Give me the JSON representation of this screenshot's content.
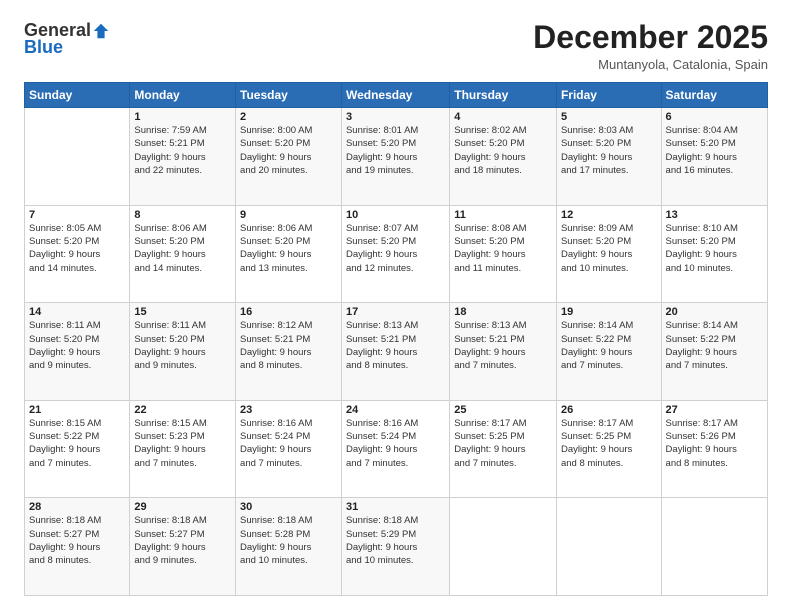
{
  "logo": {
    "general": "General",
    "blue": "Blue"
  },
  "header": {
    "month": "December 2025",
    "location": "Muntanyola, Catalonia, Spain"
  },
  "weekdays": [
    "Sunday",
    "Monday",
    "Tuesday",
    "Wednesday",
    "Thursday",
    "Friday",
    "Saturday"
  ],
  "weeks": [
    [
      {
        "day": "",
        "info": ""
      },
      {
        "day": "1",
        "info": "Sunrise: 7:59 AM\nSunset: 5:21 PM\nDaylight: 9 hours\nand 22 minutes."
      },
      {
        "day": "2",
        "info": "Sunrise: 8:00 AM\nSunset: 5:20 PM\nDaylight: 9 hours\nand 20 minutes."
      },
      {
        "day": "3",
        "info": "Sunrise: 8:01 AM\nSunset: 5:20 PM\nDaylight: 9 hours\nand 19 minutes."
      },
      {
        "day": "4",
        "info": "Sunrise: 8:02 AM\nSunset: 5:20 PM\nDaylight: 9 hours\nand 18 minutes."
      },
      {
        "day": "5",
        "info": "Sunrise: 8:03 AM\nSunset: 5:20 PM\nDaylight: 9 hours\nand 17 minutes."
      },
      {
        "day": "6",
        "info": "Sunrise: 8:04 AM\nSunset: 5:20 PM\nDaylight: 9 hours\nand 16 minutes."
      }
    ],
    [
      {
        "day": "7",
        "info": "Sunrise: 8:05 AM\nSunset: 5:20 PM\nDaylight: 9 hours\nand 14 minutes."
      },
      {
        "day": "8",
        "info": "Sunrise: 8:06 AM\nSunset: 5:20 PM\nDaylight: 9 hours\nand 14 minutes."
      },
      {
        "day": "9",
        "info": "Sunrise: 8:06 AM\nSunset: 5:20 PM\nDaylight: 9 hours\nand 13 minutes."
      },
      {
        "day": "10",
        "info": "Sunrise: 8:07 AM\nSunset: 5:20 PM\nDaylight: 9 hours\nand 12 minutes."
      },
      {
        "day": "11",
        "info": "Sunrise: 8:08 AM\nSunset: 5:20 PM\nDaylight: 9 hours\nand 11 minutes."
      },
      {
        "day": "12",
        "info": "Sunrise: 8:09 AM\nSunset: 5:20 PM\nDaylight: 9 hours\nand 10 minutes."
      },
      {
        "day": "13",
        "info": "Sunrise: 8:10 AM\nSunset: 5:20 PM\nDaylight: 9 hours\nand 10 minutes."
      }
    ],
    [
      {
        "day": "14",
        "info": "Sunrise: 8:11 AM\nSunset: 5:20 PM\nDaylight: 9 hours\nand 9 minutes."
      },
      {
        "day": "15",
        "info": "Sunrise: 8:11 AM\nSunset: 5:20 PM\nDaylight: 9 hours\nand 9 minutes."
      },
      {
        "day": "16",
        "info": "Sunrise: 8:12 AM\nSunset: 5:21 PM\nDaylight: 9 hours\nand 8 minutes."
      },
      {
        "day": "17",
        "info": "Sunrise: 8:13 AM\nSunset: 5:21 PM\nDaylight: 9 hours\nand 8 minutes."
      },
      {
        "day": "18",
        "info": "Sunrise: 8:13 AM\nSunset: 5:21 PM\nDaylight: 9 hours\nand 7 minutes."
      },
      {
        "day": "19",
        "info": "Sunrise: 8:14 AM\nSunset: 5:22 PM\nDaylight: 9 hours\nand 7 minutes."
      },
      {
        "day": "20",
        "info": "Sunrise: 8:14 AM\nSunset: 5:22 PM\nDaylight: 9 hours\nand 7 minutes."
      }
    ],
    [
      {
        "day": "21",
        "info": "Sunrise: 8:15 AM\nSunset: 5:22 PM\nDaylight: 9 hours\nand 7 minutes."
      },
      {
        "day": "22",
        "info": "Sunrise: 8:15 AM\nSunset: 5:23 PM\nDaylight: 9 hours\nand 7 minutes."
      },
      {
        "day": "23",
        "info": "Sunrise: 8:16 AM\nSunset: 5:24 PM\nDaylight: 9 hours\nand 7 minutes."
      },
      {
        "day": "24",
        "info": "Sunrise: 8:16 AM\nSunset: 5:24 PM\nDaylight: 9 hours\nand 7 minutes."
      },
      {
        "day": "25",
        "info": "Sunrise: 8:17 AM\nSunset: 5:25 PM\nDaylight: 9 hours\nand 7 minutes."
      },
      {
        "day": "26",
        "info": "Sunrise: 8:17 AM\nSunset: 5:25 PM\nDaylight: 9 hours\nand 8 minutes."
      },
      {
        "day": "27",
        "info": "Sunrise: 8:17 AM\nSunset: 5:26 PM\nDaylight: 9 hours\nand 8 minutes."
      }
    ],
    [
      {
        "day": "28",
        "info": "Sunrise: 8:18 AM\nSunset: 5:27 PM\nDaylight: 9 hours\nand 8 minutes."
      },
      {
        "day": "29",
        "info": "Sunrise: 8:18 AM\nSunset: 5:27 PM\nDaylight: 9 hours\nand 9 minutes."
      },
      {
        "day": "30",
        "info": "Sunrise: 8:18 AM\nSunset: 5:28 PM\nDaylight: 9 hours\nand 10 minutes."
      },
      {
        "day": "31",
        "info": "Sunrise: 8:18 AM\nSunset: 5:29 PM\nDaylight: 9 hours\nand 10 minutes."
      },
      {
        "day": "",
        "info": ""
      },
      {
        "day": "",
        "info": ""
      },
      {
        "day": "",
        "info": ""
      }
    ]
  ]
}
